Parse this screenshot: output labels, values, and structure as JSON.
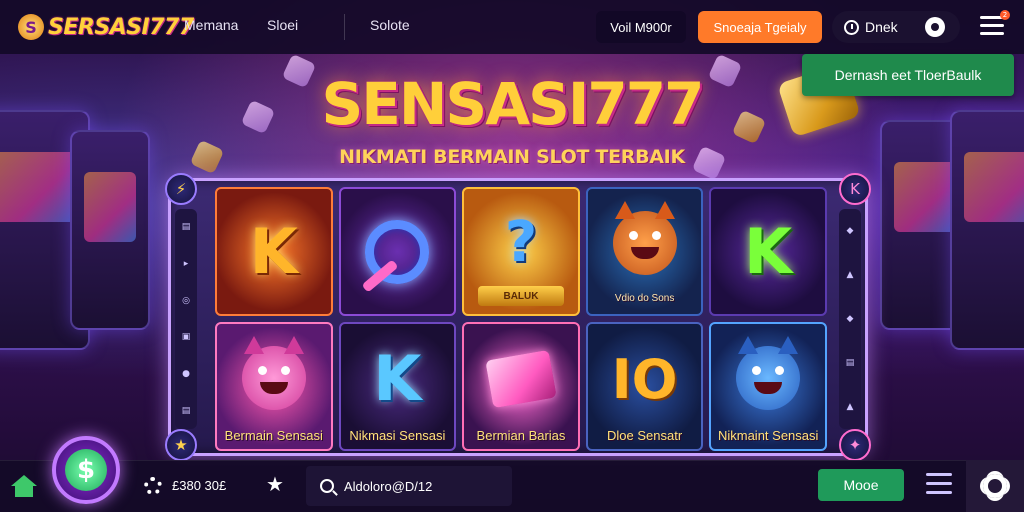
{
  "brand": {
    "logo_icon": "coin-s-icon",
    "logo_text": "SERSASI777"
  },
  "nav": {
    "link_1": "Memana",
    "link_2": "Sloei",
    "link_3": "Solote"
  },
  "header": {
    "balance": "Voil M900r",
    "deposit_label": "Snoeaja Tgeialy",
    "user_label": "Dnek",
    "menu_badge": "2"
  },
  "toast": {
    "message": "Dernash eet TloerBaulk"
  },
  "game": {
    "title": "SENSASI777",
    "subtitle": "NIKMATI BERMAIN SLOT TERBAIK"
  },
  "side_left": [
    "▤",
    "▸",
    "◎",
    "▣",
    "●",
    "▤"
  ],
  "side_right": [
    "◆",
    "▲",
    "◆",
    "▤",
    "▲"
  ],
  "reels": {
    "row1": [
      {
        "symbol": "K",
        "style": "k"
      },
      {
        "symbol": "",
        "style": "ring"
      },
      {
        "symbol": "?",
        "style": "gold",
        "badge": "BALUK"
      },
      {
        "symbol": "",
        "style": "fox",
        "label": "Vdio do Sons"
      },
      {
        "symbol": "K",
        "style": "green"
      }
    ],
    "row2": [
      {
        "symbol": "",
        "style": "pink-face",
        "label": "Bermain Sensasi"
      },
      {
        "symbol": "K",
        "style": "blue-k",
        "label": "Nikmasi Sensasi"
      },
      {
        "symbol": "",
        "style": "scroll",
        "label": "Bermian Barias"
      },
      {
        "symbol": "IO",
        "style": "io",
        "label": "Dloe Sensatr"
      },
      {
        "symbol": "",
        "style": "cat",
        "label": "Nikmaint Sensasi"
      }
    ]
  },
  "bottom": {
    "credit": "£380 30£",
    "search_value": "Aldoloro@D/12",
    "mode_label": "Mooe"
  },
  "colors": {
    "accent_orange": "#ff7a29",
    "accent_green": "#1f9a5a",
    "toast_green": "#1f8a4c",
    "title_gold": "#ffcf3a"
  }
}
